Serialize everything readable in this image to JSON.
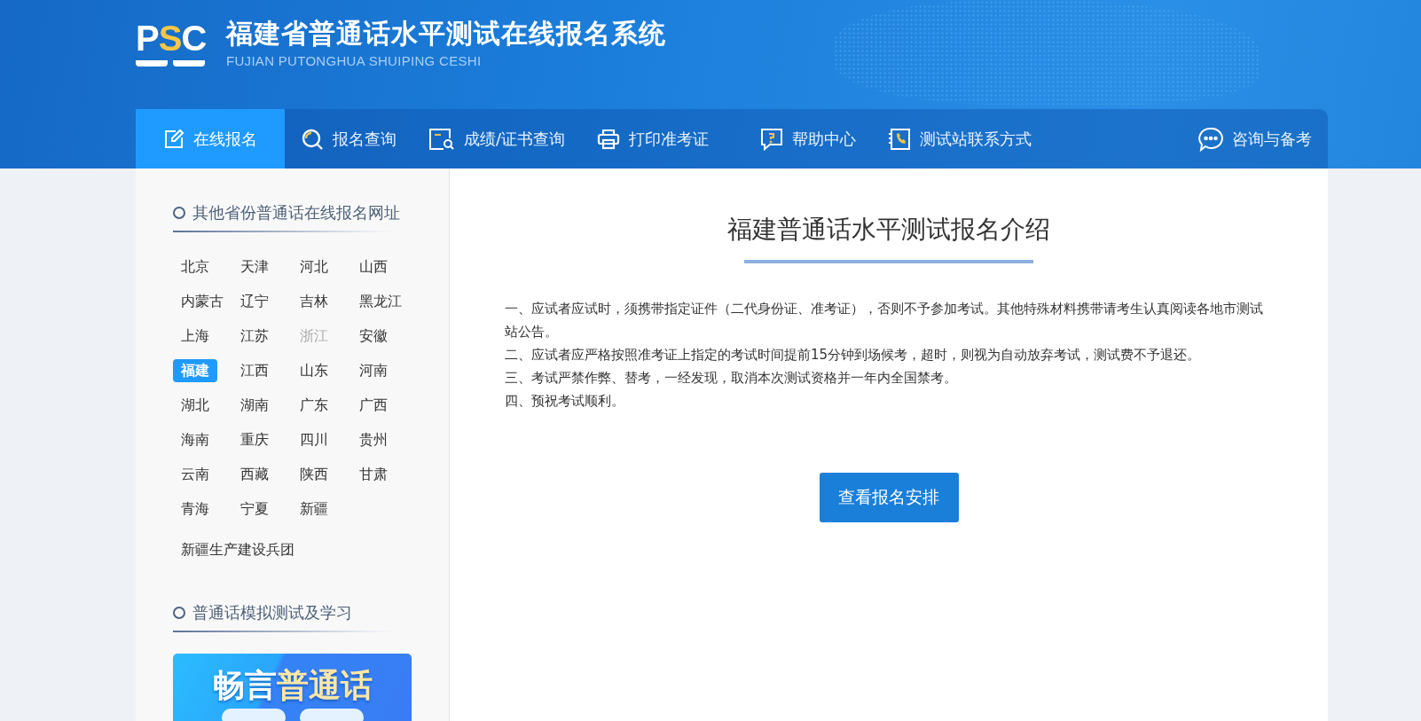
{
  "header": {
    "logo": "PSC",
    "title": "福建省普通话水平测试在线报名系统",
    "subtitle": "FUJIAN PUTONGHUA SHUIPING CESHI"
  },
  "nav": {
    "items": [
      {
        "label": "在线报名",
        "selected": true
      },
      {
        "label": "报名查询",
        "selected": false
      },
      {
        "label": "成绩/证书查询",
        "selected": false
      },
      {
        "label": "打印准考证",
        "selected": false
      },
      {
        "label": "帮助中心",
        "selected": false
      },
      {
        "label": "测试站联系方式",
        "selected": false
      }
    ],
    "consult": {
      "label": "咨询与备考"
    }
  },
  "sidebar": {
    "provinces_heading": "其他省份普通话在线报名网址",
    "provinces": [
      {
        "name": "北京",
        "selected": false,
        "disabled": false
      },
      {
        "name": "天津",
        "selected": false,
        "disabled": false
      },
      {
        "name": "河北",
        "selected": false,
        "disabled": false
      },
      {
        "name": "山西",
        "selected": false,
        "disabled": false
      },
      {
        "name": "内蒙古",
        "selected": false,
        "disabled": false
      },
      {
        "name": "辽宁",
        "selected": false,
        "disabled": false
      },
      {
        "name": "吉林",
        "selected": false,
        "disabled": false
      },
      {
        "name": "黑龙江",
        "selected": false,
        "disabled": false
      },
      {
        "name": "上海",
        "selected": false,
        "disabled": false
      },
      {
        "name": "江苏",
        "selected": false,
        "disabled": false
      },
      {
        "name": "浙江",
        "selected": false,
        "disabled": true
      },
      {
        "name": "安徽",
        "selected": false,
        "disabled": false
      },
      {
        "name": "福建",
        "selected": true,
        "disabled": false
      },
      {
        "name": "江西",
        "selected": false,
        "disabled": false
      },
      {
        "name": "山东",
        "selected": false,
        "disabled": false
      },
      {
        "name": "河南",
        "selected": false,
        "disabled": false
      },
      {
        "name": "湖北",
        "selected": false,
        "disabled": false
      },
      {
        "name": "湖南",
        "selected": false,
        "disabled": false
      },
      {
        "name": "广东",
        "selected": false,
        "disabled": false
      },
      {
        "name": "广西",
        "selected": false,
        "disabled": false
      },
      {
        "name": "海南",
        "selected": false,
        "disabled": false
      },
      {
        "name": "重庆",
        "selected": false,
        "disabled": false
      },
      {
        "name": "四川",
        "selected": false,
        "disabled": false
      },
      {
        "name": "贵州",
        "selected": false,
        "disabled": false
      },
      {
        "name": "云南",
        "selected": false,
        "disabled": false
      },
      {
        "name": "西藏",
        "selected": false,
        "disabled": false
      },
      {
        "name": "陕西",
        "selected": false,
        "disabled": false
      },
      {
        "name": "甘肃",
        "selected": false,
        "disabled": false
      },
      {
        "name": "青海",
        "selected": false,
        "disabled": false
      },
      {
        "name": "宁夏",
        "selected": false,
        "disabled": false
      },
      {
        "name": "新疆",
        "selected": false,
        "disabled": false
      }
    ],
    "corps": {
      "name": "新疆生产建设兵团",
      "selected": false,
      "disabled": false
    },
    "study_heading": "普通话模拟测试及学习",
    "banner": {
      "text_white": "畅言",
      "text_yellow": "普通话"
    }
  },
  "main": {
    "title": "福建普通话水平测试报名介绍",
    "paragraphs": [
      "一、应试者应试时，须携带指定证件（二代身份证、准考证），否则不予参加考试。其他特殊材料携带请考生认真阅读各地市测试站公告。",
      "二、应试者应严格按照准考证上指定的考试时间提前15分钟到场候考，超时，则视为自动放弃考试，测试费不予退还。",
      "三、考试严禁作弊、替考，一经发现，取消本次测试资格并一年内全国禁考。",
      "四、预祝考试顺利。"
    ],
    "button": "查看报名安排"
  }
}
